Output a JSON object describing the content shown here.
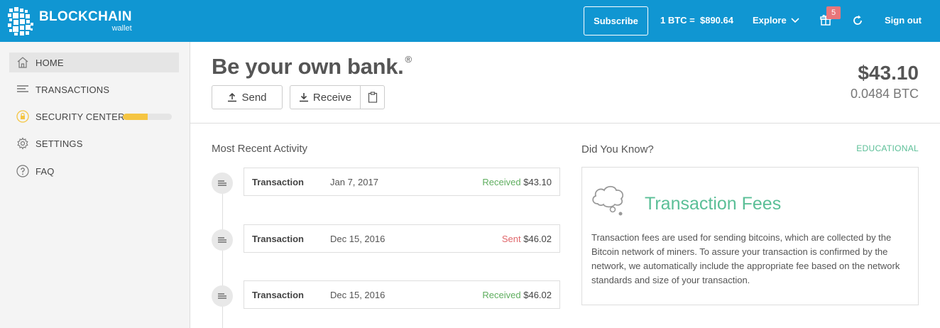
{
  "header": {
    "logo_name": "BLOCKCHAIN",
    "logo_sub": "wallet",
    "subscribe_label": "Subscribe",
    "rate_text": "1 BTC =  $890.64",
    "explore_label": "Explore",
    "notification_count": "5",
    "signout_label": "Sign out",
    "icons": [
      "blockchain-logo",
      "chevron-down-icon",
      "gift-icon",
      "refresh-icon"
    ]
  },
  "sidebar": {
    "items": [
      {
        "label": "HOME",
        "icon": "home-icon",
        "active": true
      },
      {
        "label": "TRANSACTIONS",
        "icon": "list-icon"
      },
      {
        "label": "SECURITY CENTER",
        "icon": "lock-icon",
        "progress": 0.5
      },
      {
        "label": "SETTINGS",
        "icon": "gear-icon"
      },
      {
        "label": "FAQ",
        "icon": "question-icon"
      }
    ]
  },
  "main": {
    "tagline": "Be your own bank.",
    "tagline_mark": "®",
    "send_label": "Send",
    "receive_label": "Receive",
    "balance_usd": "$43.10",
    "balance_btc": "0.0484 BTC"
  },
  "activity": {
    "title": "Most Recent Activity",
    "transactions": [
      {
        "type": "Transaction",
        "date": "Jan 7, 2017",
        "status": "Received",
        "amount": "$43.10"
      },
      {
        "type": "Transaction",
        "date": "Dec 15, 2016",
        "status": "Sent",
        "amount": "$46.02"
      },
      {
        "type": "Transaction",
        "date": "Dec 15, 2016",
        "status": "Received",
        "amount": "$46.02"
      }
    ]
  },
  "did_you_know": {
    "title": "Did You Know?",
    "tag": "EDUCATIONAL",
    "card_title": "Transaction Fees",
    "card_text": "Transaction fees are used for sending bitcoins, which are collected by the Bitcoin network of miners. To assure your transaction is confirmed by the network, we automatically include the appropriate fee based on the network standards and size of your transaction."
  },
  "colors": {
    "header_bg": "#1096d2",
    "received": "#5fae5f",
    "sent": "#e0676b",
    "accent_green": "#5bbf97",
    "security_bar": "#f5c542",
    "badge": "#e8767a"
  }
}
